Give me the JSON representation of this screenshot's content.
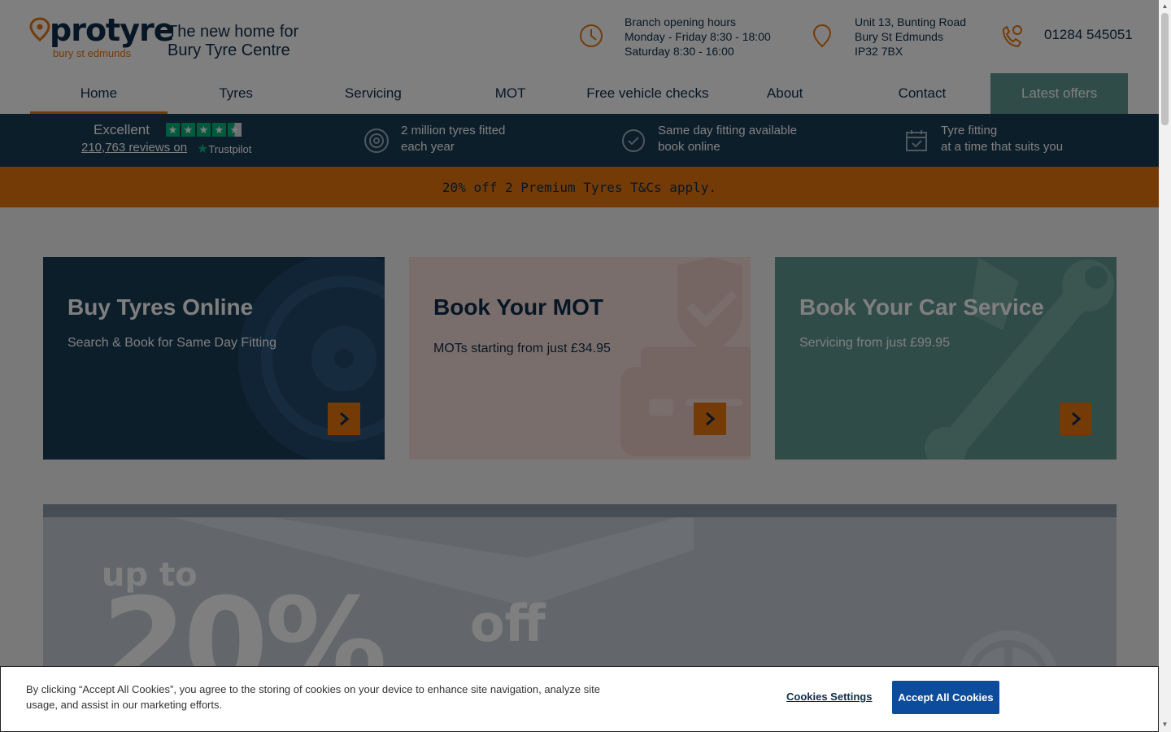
{
  "header": {
    "brand": "protyre",
    "brand_location": "bury st edmunds",
    "tagline_line1": "The new home for",
    "tagline_line2": "Bury Tyre Centre",
    "hours": {
      "title": "Branch opening hours",
      "weekday": "Monday - Friday 8:30 - 18:00",
      "saturday": "Saturday 8:30 - 16:00"
    },
    "address": {
      "line1": "Unit 13, Bunting Road",
      "line2": "Bury St Edmunds",
      "line3": "IP32 7BX"
    },
    "phone": "01284 545051"
  },
  "nav": {
    "items": [
      {
        "label": "Home"
      },
      {
        "label": "Tyres"
      },
      {
        "label": "Servicing"
      },
      {
        "label": "MOT"
      },
      {
        "label": "Free vehicle checks"
      },
      {
        "label": "About"
      },
      {
        "label": "Contact"
      },
      {
        "label": "Latest offers"
      }
    ]
  },
  "trustbar": {
    "rating_word": "Excellent",
    "reviews_text": "210,763 reviews on",
    "trustpilot": "Trustpilot",
    "feature1_line1": "2 million tyres fitted",
    "feature1_line2": "each year",
    "feature2_line1": "Same day fitting available",
    "feature2_line2": "book online",
    "feature3_line1": "Tyre fitting",
    "feature3_line2": "at a time that suits you"
  },
  "promo": {
    "text": "20% off 2 Premium Tyres T&Cs apply."
  },
  "cards": [
    {
      "title": "Buy Tyres Online",
      "subtitle": "Search & Book for Same Day Fitting",
      "bg": "#1b3c56",
      "fg": "#ffffff"
    },
    {
      "title": "Book Your MOT",
      "subtitle": "MOTs starting from just £34.95",
      "bg": "#f5ddd8",
      "fg": "#0f2d4a"
    },
    {
      "title": "Book Your Car Service",
      "subtitle": "Servicing from just £99.95",
      "bg": "#5f9990",
      "fg": "#ffffff"
    }
  ],
  "hero": {
    "upto": "up to",
    "number": "20%",
    "off": "off"
  },
  "cookie": {
    "text": "By clicking “Accept All Cookies”, you agree to the storing of cookies on your device to enhance site navigation, analyze site usage, and assist in our marketing efforts.",
    "settings_label": "Cookies Settings",
    "accept_label": "Accept All Cookies"
  },
  "colors": {
    "brand_navy": "#0f2d4a",
    "brand_orange": "#e8770f",
    "teal": "#5f9990",
    "accept_blue": "#0d4c9a"
  }
}
